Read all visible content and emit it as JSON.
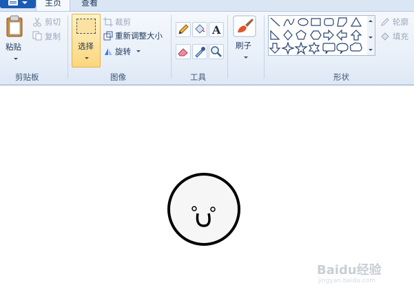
{
  "tabs": {
    "home": "主页",
    "view": "查看"
  },
  "clipboard": {
    "paste": "粘贴",
    "cut": "剪切",
    "copy": "复制",
    "group": "剪贴板"
  },
  "image": {
    "select": "选择",
    "crop": "裁剪",
    "resize": "重新调整大小",
    "rotate": "旋转",
    "group": "图像"
  },
  "tools": {
    "group": "工具"
  },
  "brushes": {
    "label": "刷子"
  },
  "shapes": {
    "group": "形状",
    "outline": "轮廓",
    "fill": "填充"
  },
  "watermark": {
    "text": "Baidu经验",
    "sub": "jingyan.baidu.com"
  },
  "colors": {
    "ribbon_bg": "#f5f8fc",
    "select_highlight": "#fbd77c",
    "accent": "#1b5bb4"
  }
}
